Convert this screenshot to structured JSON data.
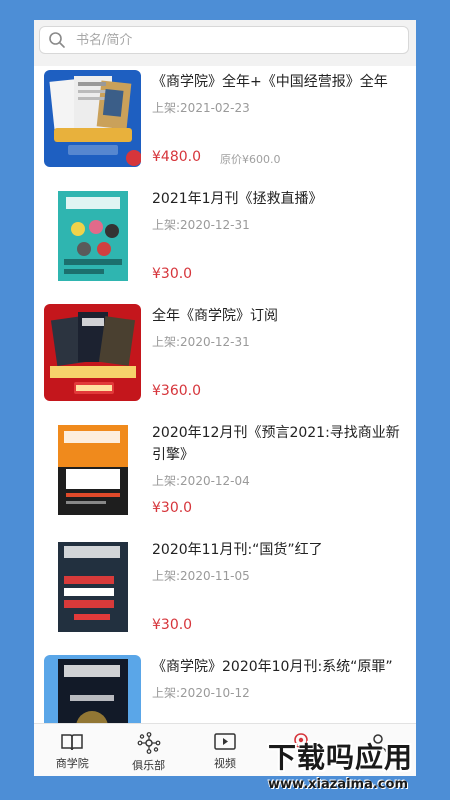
{
  "search": {
    "placeholder": "书名/简介"
  },
  "items": [
    {
      "title": "《商学院》全年+《中国经营报》全年",
      "date": "上架:2021-02-23",
      "price": "¥480.0",
      "original_price": "原价¥600.0"
    },
    {
      "title": "2021年1月刊《拯救直播》",
      "date": "上架:2020-12-31",
      "price": "¥30.0"
    },
    {
      "title": "全年《商学院》订阅",
      "date": "上架:2020-12-31",
      "price": "¥360.0"
    },
    {
      "title": "2020年12月刊《预言2021:寻找商业新引擎》",
      "date": "上架:2020-12-04",
      "price": "¥30.0"
    },
    {
      "title": "2020年11月刊:“国货”红了",
      "date": "上架:2020-11-05",
      "price": "¥30.0"
    },
    {
      "title": "《商学院》2020年10月刊:系统“原罪”",
      "date": "上架:2020-10-12"
    }
  ],
  "tabs": [
    {
      "label": "商学院",
      "icon": "book-icon"
    },
    {
      "label": "俱乐部",
      "icon": "network-icon"
    },
    {
      "label": "视频",
      "icon": "video-icon"
    },
    {
      "label": "",
      "icon": "location-icon"
    },
    {
      "label": "",
      "icon": "user-icon"
    }
  ],
  "watermark": {
    "main": "下载吗应用",
    "url": "www.xiazaima.com"
  },
  "colors": {
    "background": "#4d8ed6",
    "price": "#d6353b",
    "accent": "#d6353b"
  }
}
